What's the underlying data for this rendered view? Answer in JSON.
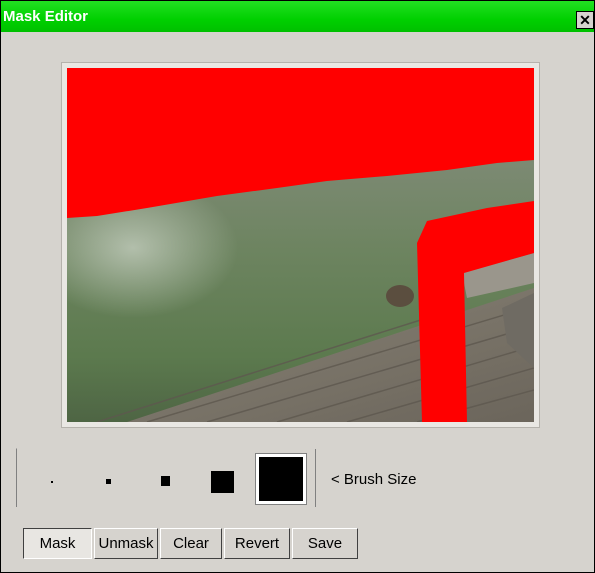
{
  "window": {
    "title": "Mask Editor",
    "close_glyph": "✕"
  },
  "brush_panel": {
    "label": "< Brush Size",
    "sizes": [
      "tiny",
      "small",
      "medium",
      "large",
      "extra-large"
    ],
    "selected": "extra-large"
  },
  "buttons": [
    {
      "label": "Mask",
      "pressed": true
    },
    {
      "label": "Unmask",
      "pressed": false
    },
    {
      "label": "Clear",
      "pressed": false
    },
    {
      "label": "Revert",
      "pressed": false
    },
    {
      "label": "Save",
      "pressed": false
    }
  ],
  "colors": {
    "titlebar": "#00d000",
    "mask": "#ff0000",
    "window_bg": "#d6d3ce"
  }
}
